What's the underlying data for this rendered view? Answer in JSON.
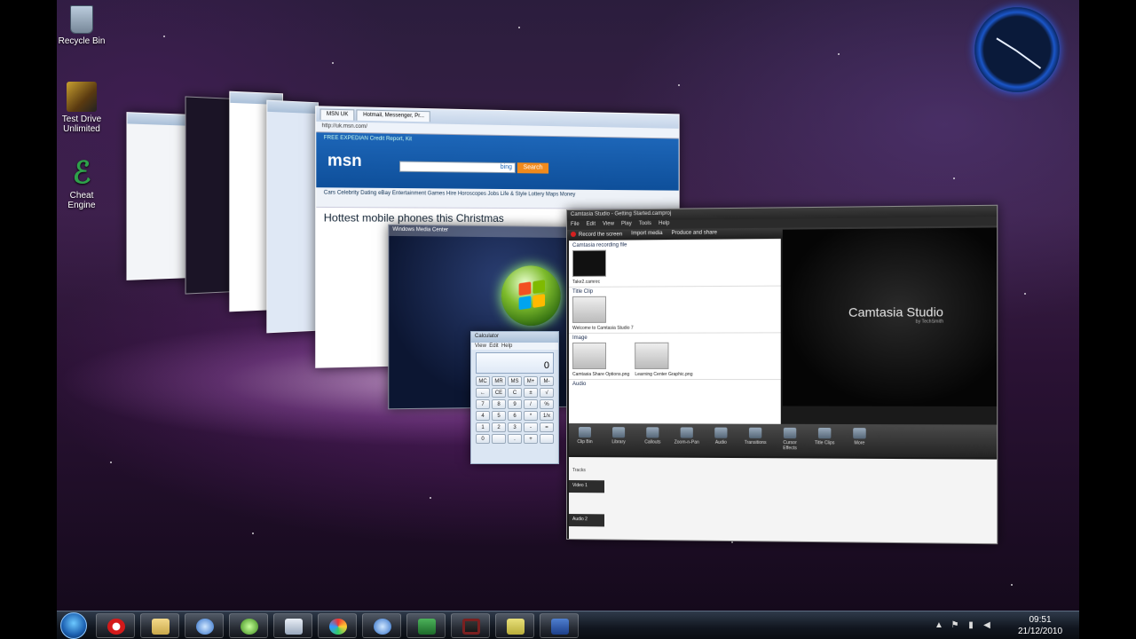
{
  "desktop": {
    "icons": [
      {
        "label": "Recycle Bin"
      },
      {
        "label": "Test Drive Unlimited"
      },
      {
        "label": "Cheat Engine"
      }
    ]
  },
  "windows": {
    "ie": {
      "tabs": [
        "MSN UK",
        "Hotmail, Messenger, Pr..."
      ],
      "address": "http://uk.msn.com/",
      "banner": "FREE EXPEDIAN Credit Report, Kit",
      "logo": "msn",
      "search_button": "Search",
      "search_brand": "bing",
      "nav": "Cars  Celebrity  Dating  eBay  Entertainment  Games  Hire  Horoscopes  Jobs  Life & Style  Lottery  Maps  Money",
      "headline": "Hottest mobile phones this Christmas"
    },
    "wmc": {
      "title": "Windows Media Center"
    },
    "calculator": {
      "title": "Calculator",
      "menu": [
        "View",
        "Edit",
        "Help"
      ],
      "display": "0",
      "keys": [
        "MC",
        "MR",
        "MS",
        "M+",
        "M-",
        "←",
        "CE",
        "C",
        "±",
        "√",
        "7",
        "8",
        "9",
        "/",
        "%",
        "4",
        "5",
        "6",
        "*",
        "1/x",
        "1",
        "2",
        "3",
        "-",
        "=",
        "0",
        "",
        ".",
        "+",
        ""
      ]
    },
    "camtasia": {
      "title": "Camtasia Studio - Getting Started.camproj",
      "menu": [
        "File",
        "Edit",
        "View",
        "Play",
        "Tools",
        "Help"
      ],
      "record_label": "Record the screen",
      "import_label": "Import media",
      "produce_label": "Produce and share",
      "sections": [
        {
          "title": "Camtasia recording file",
          "items": [
            "Take2.camrec"
          ]
        },
        {
          "title": "Title Clip",
          "items": [
            "Welcome to Camtasia Studio 7"
          ]
        },
        {
          "title": "Image",
          "items": [
            "Camtasia Share Options.png",
            "Learning Center Graphic.png"
          ]
        },
        {
          "title": "Audio",
          "items": []
        }
      ],
      "preview_logo": "Camtasia Studio",
      "preview_brand": "by TechSmith",
      "tasks": [
        "Clip Bin",
        "Library",
        "Callouts",
        "Zoom-n-Pan",
        "Audio",
        "Transitions",
        "Cursor Effects",
        "Title Clips",
        "More"
      ],
      "timeline_label": "Tracks",
      "tracks": [
        "Video 1",
        "Audio 2"
      ]
    }
  },
  "taskbar": {
    "time": "09:51",
    "date": "21/12/2010",
    "tray_icons": [
      "flag-icon",
      "network-icon",
      "volume-icon"
    ]
  }
}
